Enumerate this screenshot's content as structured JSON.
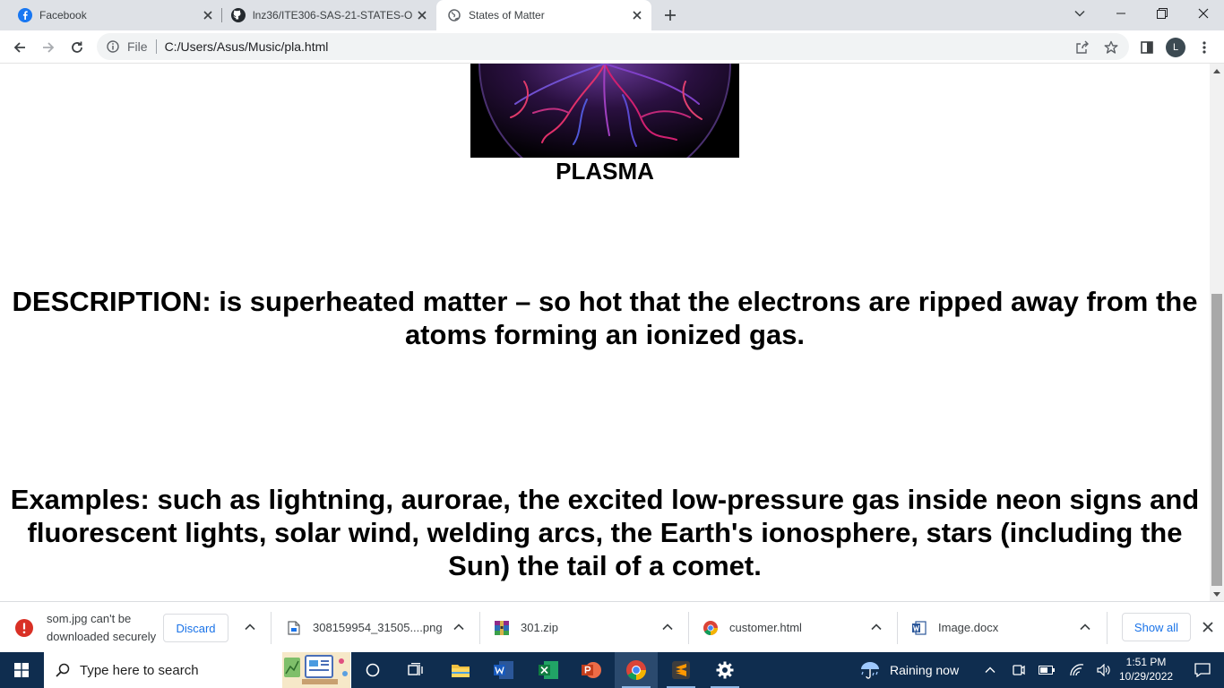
{
  "browser": {
    "tabs": [
      {
        "title": "Facebook",
        "favicon": "facebook-icon",
        "active": false
      },
      {
        "title": "lnz36/ITE306-SAS-21-STATES-OF",
        "favicon": "github-icon",
        "active": false
      },
      {
        "title": "States of Matter",
        "favicon": "globe-icon",
        "active": true
      }
    ],
    "new_tab": "+",
    "address": {
      "scheme_label": "File",
      "url": "C:/Users/Asus/Music/pla.html"
    },
    "profile_initial": "L"
  },
  "page": {
    "image_caption": "PLASMA",
    "description": "DESCRIPTION: is superheated matter – so hot that the electrons are ripped away from the atoms forming an ionized gas.",
    "examples": "Examples: such as lightning, aurorae, the excited low-pressure gas inside neon signs and fluorescent lights, solar wind, welding arcs, the Earth's ionosphere, stars (including the Sun) the tail of a comet."
  },
  "downloads": {
    "items": [
      {
        "name_line1": "som.jpg can't be",
        "name_line2": "downloaded securely",
        "icon": "error-icon",
        "action": "Discard"
      },
      {
        "name": "308159954_31505....png",
        "icon": "image-file-icon"
      },
      {
        "name": "301.zip",
        "icon": "zip-archive-icon"
      },
      {
        "name": "customer.html",
        "icon": "chrome-icon"
      },
      {
        "name": "Image.docx",
        "icon": "word-doc-icon"
      }
    ],
    "show_all": "Show all"
  },
  "taskbar": {
    "search_placeholder": "Type here to search",
    "weather": "Raining now",
    "time": "1:51 PM",
    "date": "10/29/2022"
  },
  "colors": {
    "tabstrip": "#dee1e6",
    "taskbar": "#0f2d4f",
    "link_blue": "#1a73e8",
    "error_red": "#d93025"
  }
}
